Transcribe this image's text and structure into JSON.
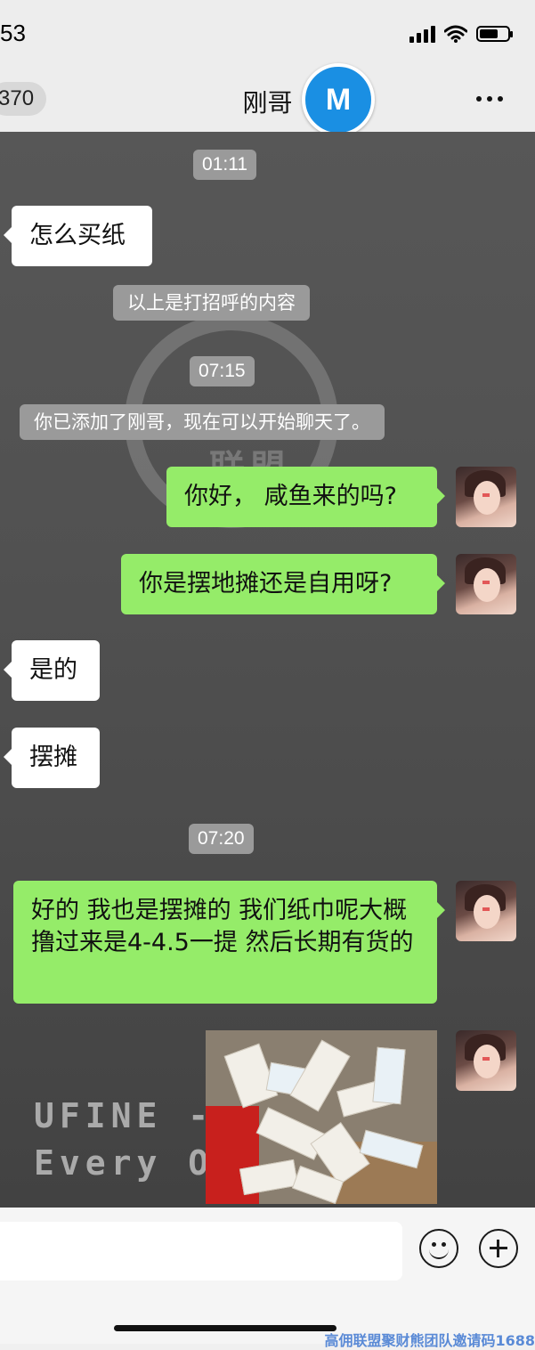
{
  "status_bar": {
    "time": "53"
  },
  "nav": {
    "back_count": "370",
    "title": "刚哥",
    "logo_text": "M"
  },
  "messages": {
    "ts1": "01:11",
    "in1": "怎么买纸",
    "sys1": "以上是打招呼的内容",
    "ts2": "07:15",
    "sys2": "你已添加了刚哥，现在可以开始聊天了。",
    "out1": "你好， 咸鱼来的吗?",
    "out2": "你是摆地摊还是自用呀?",
    "in2": "是的",
    "in3": "摆摊",
    "ts3": "07:20",
    "out3": "好的 我也是摆摊的 我们纸巾呢大概撸过来是4-4.5一提 然后长期有货的"
  },
  "background_watermark": {
    "logo_text": "联盟",
    "line1": "UFINE -",
    "line2": "Every On"
  },
  "footer_watermark": "高佣联盟聚财熊团队邀请码1688",
  "icons": [
    "signal-icon",
    "wifi-icon",
    "battery-icon",
    "more-icon",
    "emoji-icon",
    "plus-icon"
  ],
  "colors": {
    "outgoing_bubble": "#95ec69",
    "incoming_bubble": "#ffffff",
    "logo_blue": "#1a8fe3"
  }
}
